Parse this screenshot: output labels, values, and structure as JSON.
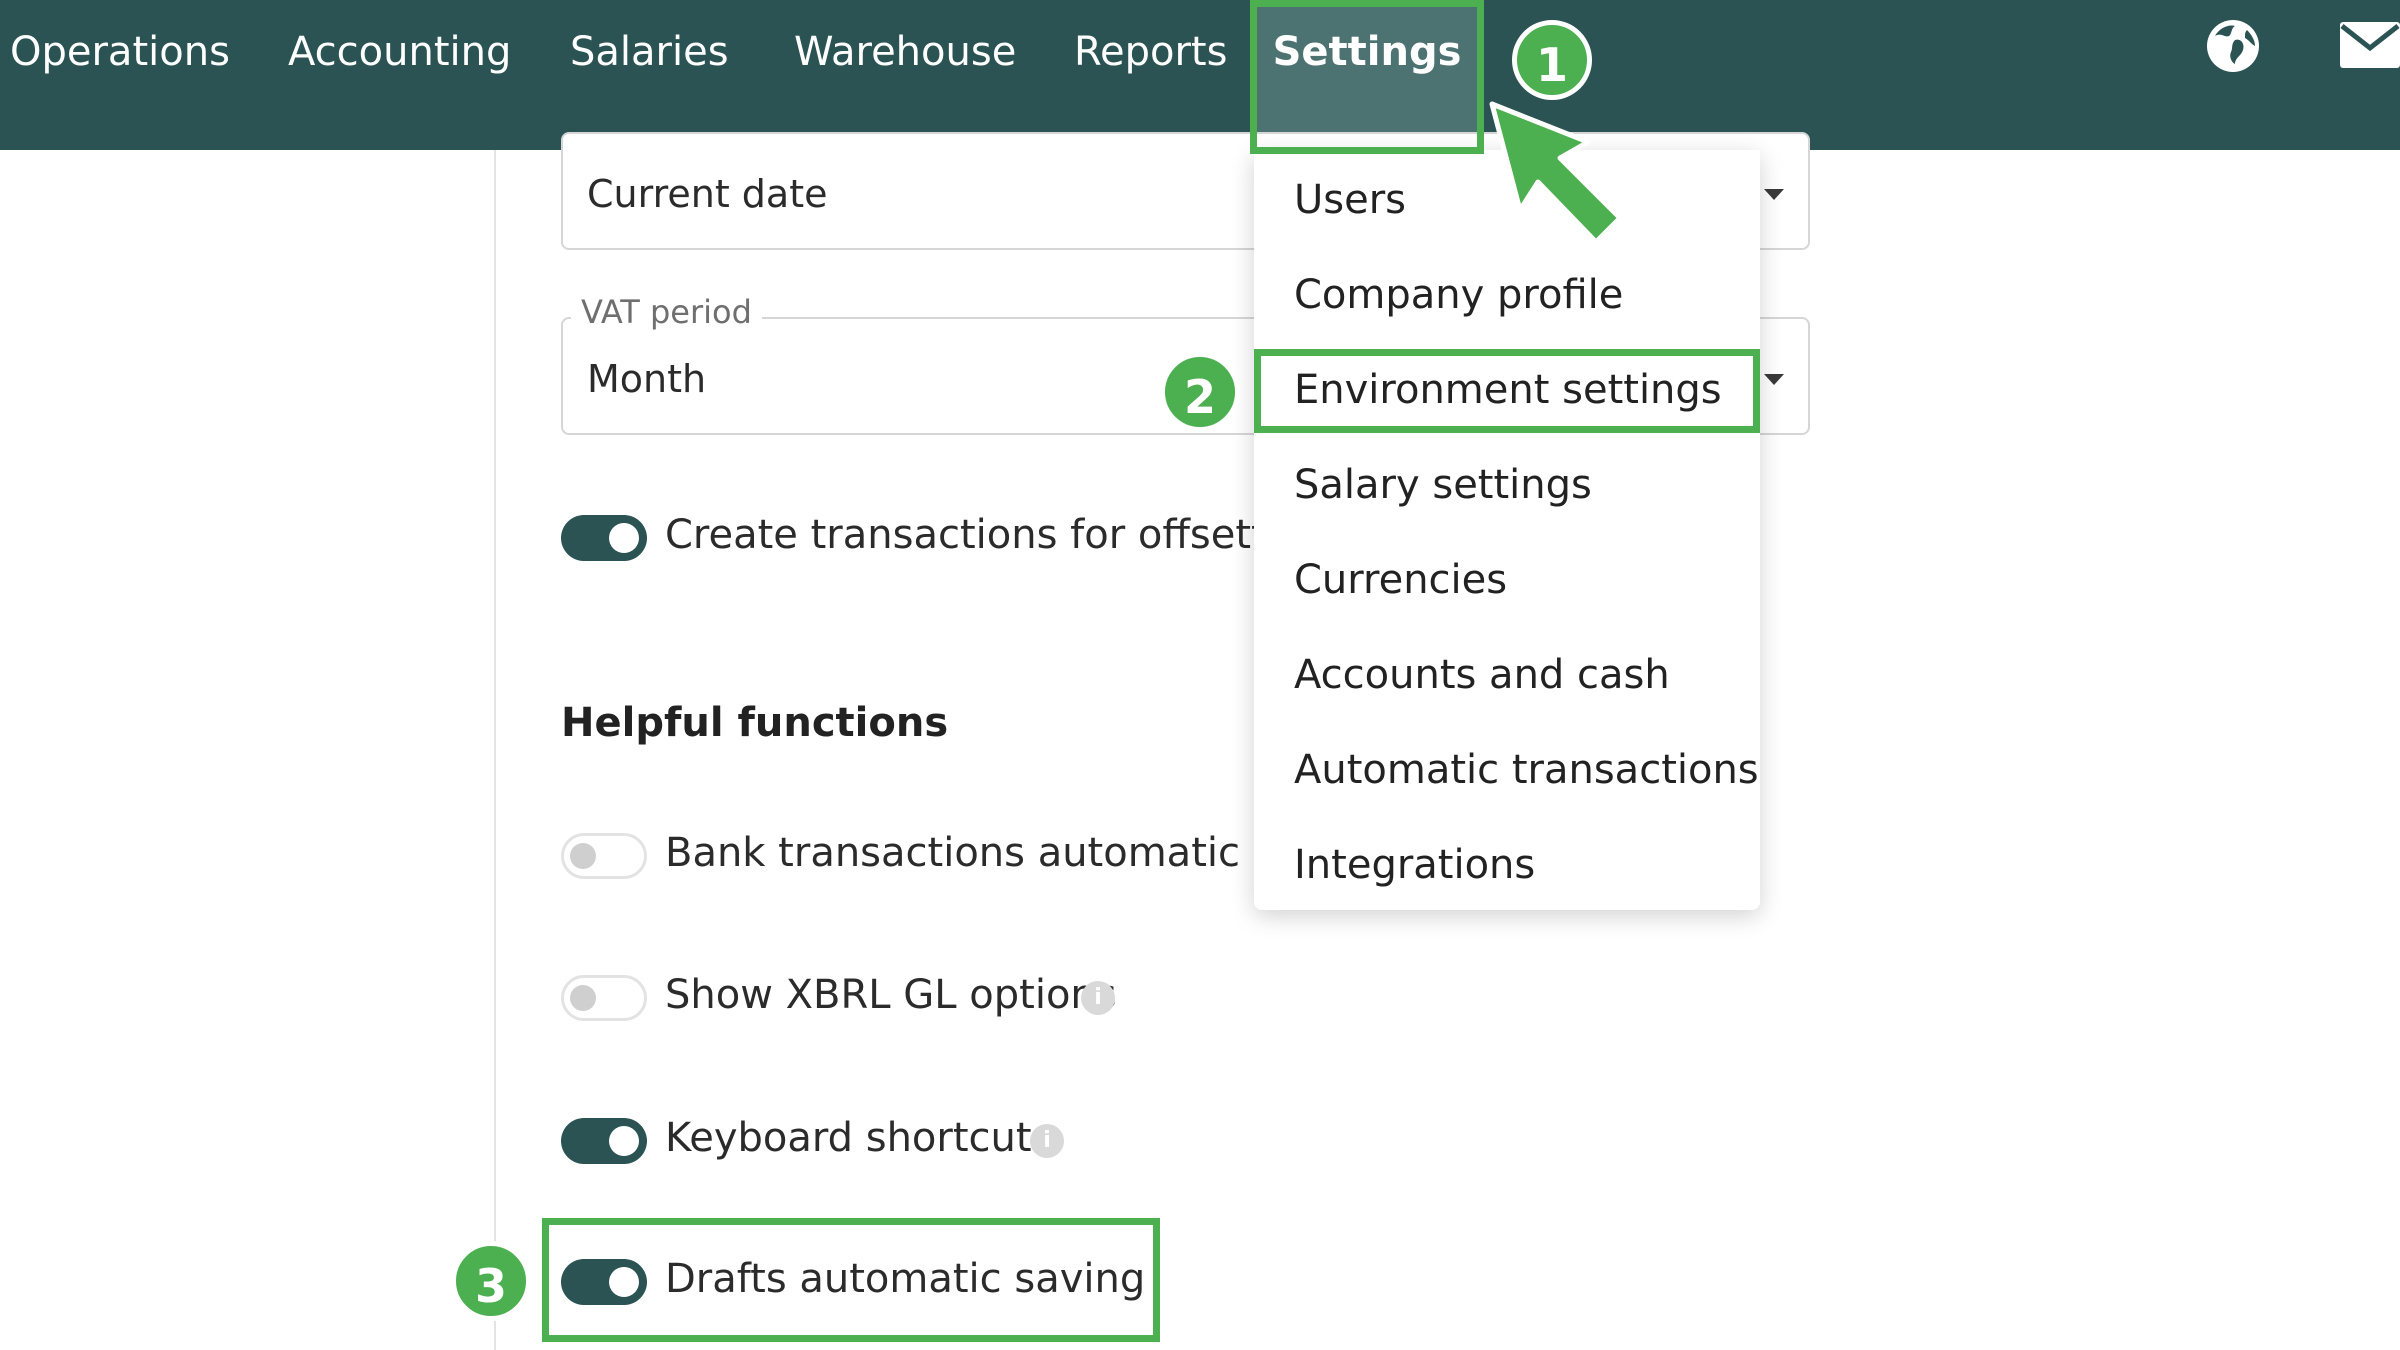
{
  "nav": {
    "items": [
      {
        "label": "Operations"
      },
      {
        "label": "Accounting"
      },
      {
        "label": "Salaries"
      },
      {
        "label": "Warehouse"
      },
      {
        "label": "Reports"
      },
      {
        "label": "Settings",
        "active": true
      }
    ],
    "icons": [
      "globe-icon",
      "mail-icon"
    ]
  },
  "form": {
    "date_select": {
      "value": "Current date"
    },
    "vat_period": {
      "label": "VAT period",
      "value": "Month"
    },
    "offsetting_toggle": {
      "label": "Create transactions for offsetting",
      "on": true
    },
    "helpful_heading": "Helpful functions",
    "toggles": [
      {
        "label": "Bank transactions automatic proc",
        "on": false
      },
      {
        "label": "Show XBRL GL options",
        "on": false,
        "info": true
      },
      {
        "label": "Keyboard shortcuts",
        "on": true,
        "info": true
      },
      {
        "label": "Drafts automatic saving",
        "on": true
      }
    ]
  },
  "settings_menu": {
    "items": [
      {
        "label": "Users"
      },
      {
        "label": "Company profile"
      },
      {
        "label": "Environment settings",
        "highlighted": true
      },
      {
        "label": "Salary settings"
      },
      {
        "label": "Currencies"
      },
      {
        "label": "Accounts and cash"
      },
      {
        "label": "Automatic transactions"
      },
      {
        "label": "Integrations"
      }
    ]
  },
  "annotations": {
    "steps": [
      "1",
      "2",
      "3"
    ],
    "highlight_color": "#4caf50"
  },
  "colors": {
    "topbar": "#2b5353",
    "active_tab": "#4d7272",
    "toggle_on": "#2b5353",
    "accent_green": "#4caf50"
  }
}
